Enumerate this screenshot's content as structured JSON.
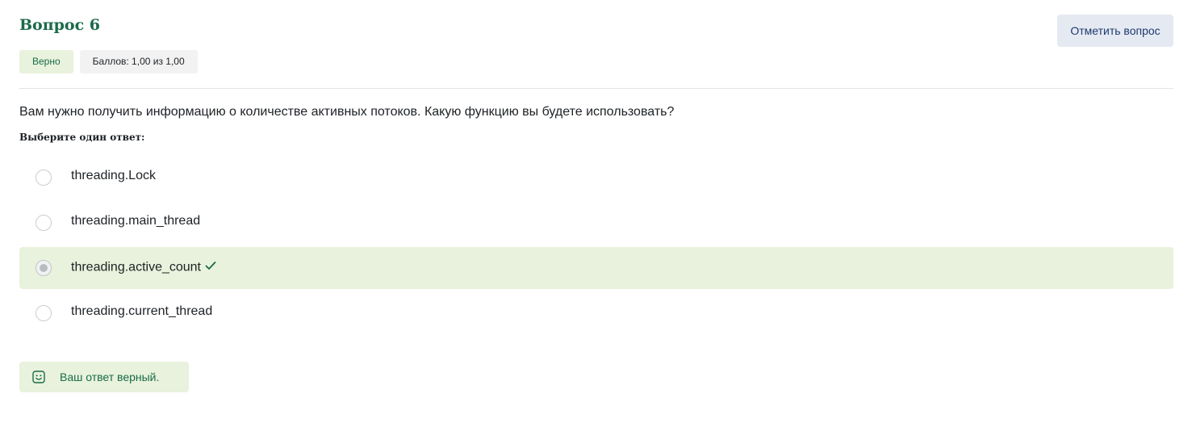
{
  "question": {
    "title": "Вопрос 6",
    "state": "Верно",
    "grade": "Баллов: 1,00 из 1,00",
    "flag_label": "Отметить вопрос",
    "text": "Вам нужно получить информацию о количестве активных потоков. Какую функцию вы будете использовать?",
    "prompt": "Выберите один ответ:"
  },
  "answers": [
    {
      "label": "threading.Lock",
      "selected": false,
      "correct": false
    },
    {
      "label": "threading.main_thread",
      "selected": false,
      "correct": false
    },
    {
      "label": "threading.active_count",
      "selected": true,
      "correct": true
    },
    {
      "label": "threading.current_thread",
      "selected": false,
      "correct": false
    }
  ],
  "feedback": {
    "text": "Ваш ответ верный.",
    "icon": "smile-icon"
  },
  "colors": {
    "accent_green": "#1a6b4a",
    "correct_bg": "#e8f2dc",
    "flag_bg": "#e5e9f2",
    "flag_text": "#1e3a6e"
  }
}
